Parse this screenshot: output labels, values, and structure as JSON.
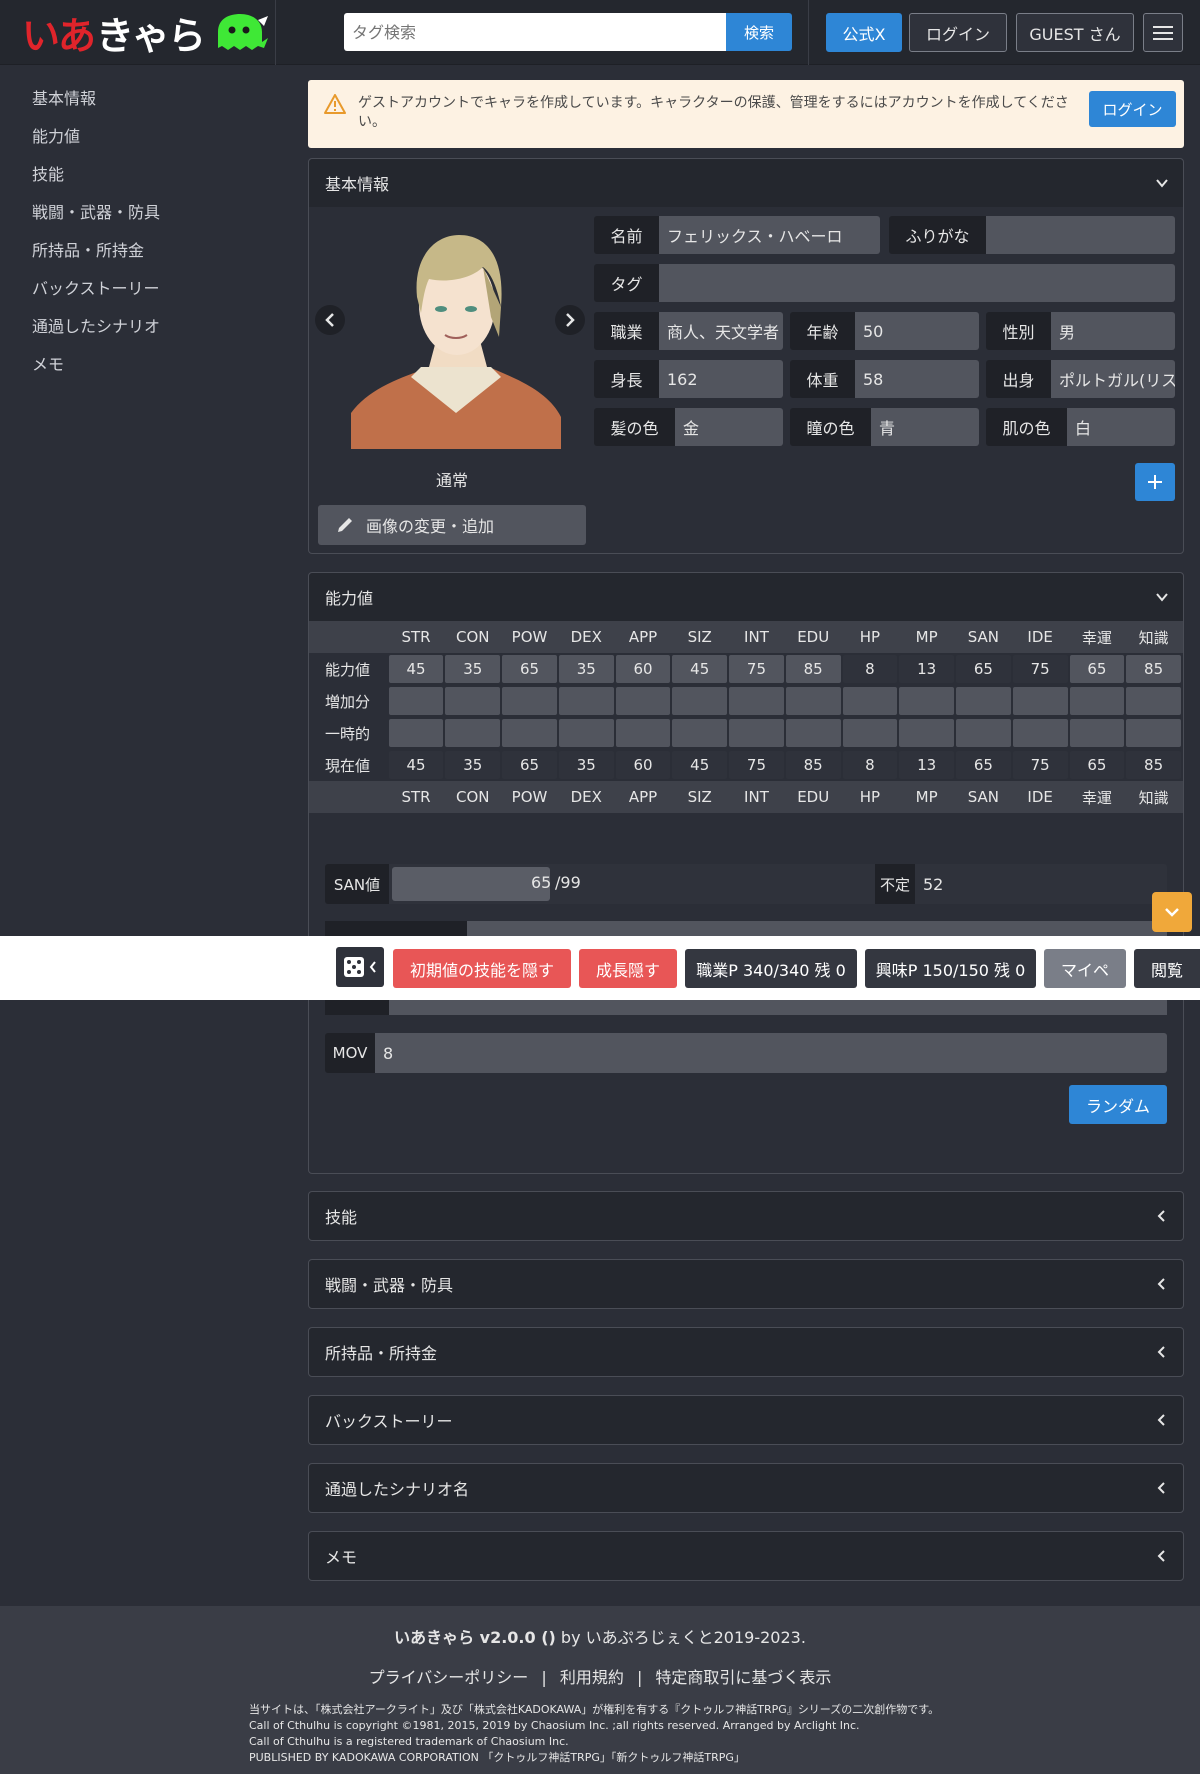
{
  "header": {
    "logo_part1": "いあ",
    "logo_part2": "きゃら",
    "search_placeholder": "タグ検索",
    "search_button": "検索",
    "x_button": "公式X",
    "login_button": "ログイン",
    "guest_button": "GUEST さん"
  },
  "sidebar": {
    "items": [
      "基本情報",
      "能力値",
      "技能",
      "戦闘・武器・防具",
      "所持品・所持金",
      "バックストーリー",
      "通過したシナリオ",
      "メモ"
    ]
  },
  "alert": {
    "text": "ゲストアカウントでキャラを作成しています。キャラクターの保護、管理をするにはアカウントを作成してください。",
    "login_button": "ログイン"
  },
  "basic_info": {
    "title": "基本情報",
    "portrait_caption": "通常",
    "change_image_button": "画像の変更・追加",
    "fields": {
      "name_label": "名前",
      "name_value": "フェリックス・ハベーロ",
      "furigana_label": "ふりがな",
      "furigana_value": "",
      "tag_label": "タグ",
      "tag_value": "",
      "job_label": "職業",
      "job_value": "商人、天文学者",
      "age_label": "年齢",
      "age_value": "50",
      "sex_label": "性別",
      "sex_value": "男",
      "height_label": "身長",
      "height_value": "162",
      "weight_label": "体重",
      "weight_value": "58",
      "origin_label": "出身",
      "origin_value": "ポルトガル(リスボン)",
      "hair_label": "髪の色",
      "hair_value": "金",
      "eye_label": "瞳の色",
      "eye_value": "青",
      "skin_label": "肌の色",
      "skin_value": "白"
    }
  },
  "abilities": {
    "title": "能力値",
    "stats": [
      "STR",
      "CON",
      "POW",
      "DEX",
      "APP",
      "SIZ",
      "INT",
      "EDU",
      "HP",
      "MP",
      "SAN",
      "IDE",
      "幸運",
      "知識"
    ],
    "row_labels": [
      "能力値",
      "増加分",
      "一時的",
      "現在値"
    ],
    "base": [
      "45",
      "35",
      "65",
      "35",
      "60",
      "45",
      "75",
      "85",
      "8",
      "13",
      "65",
      "75",
      "65",
      "85"
    ],
    "current": [
      "45",
      "35",
      "65",
      "35",
      "60",
      "45",
      "75",
      "85",
      "8",
      "13",
      "65",
      "75",
      "65",
      "85"
    ],
    "san_label": "SAN値",
    "san_current": "65",
    "san_max": "/99",
    "san_fraction": 0.657,
    "indef_label": "不定",
    "indef_value": "52",
    "mov_label": "MOV",
    "mov_value": "8",
    "random_button": "ランダム"
  },
  "toolbar": {
    "hide_initial": "初期値の技能を隠す",
    "hide_growth": "成長隠す",
    "job_points": "職業P 340/340 残 0",
    "hobby_points": "興味P 150/150 残 0",
    "mypage": "マイペ",
    "view": "閲覧"
  },
  "sections": [
    "技能",
    "戦闘・武器・防具",
    "所持品・所持金",
    "バックストーリー",
    "通過したシナリオ名",
    "メモ"
  ],
  "footer": {
    "title_bold": "いあきゃら v2.0.0 ()",
    "title_rest": " by いあぷろじぇくと2019-2023.",
    "links": [
      "プライバシーポリシー",
      "利用規約",
      "特定商取引に基づく表示"
    ],
    "separator": "|",
    "legal": [
      "当サイトは、「株式会社アークライト」及び「株式会社KADOKAWA」が権利を有する『クトゥルフ神話TRPG』シリーズの二次創作物です。",
      "Call of Cthulhu is copyright ©1981, 2015, 2019 by Chaosium Inc. ;all rights reserved. Arranged by Arclight Inc.",
      "Call of Cthulhu is a registered trademark of Chaosium Inc.",
      "PUBLISHED BY KADOKAWA CORPORATION 「クトゥルフ神話TRPG」「新クトゥルフ神話TRPG」"
    ]
  },
  "colors": {
    "accent_blue": "#2e86d6",
    "danger_red": "#e85656",
    "warning_orange": "#f0a83a",
    "logo_red": "#e0242b",
    "logo_green": "#3fe836"
  },
  "icons": {
    "alert": "warning-icon",
    "menu": "hamburger-icon",
    "chevron": "chevron-down-icon",
    "pencil": "pencil-icon",
    "dice": "dice-icon",
    "plus": "plus-icon"
  }
}
